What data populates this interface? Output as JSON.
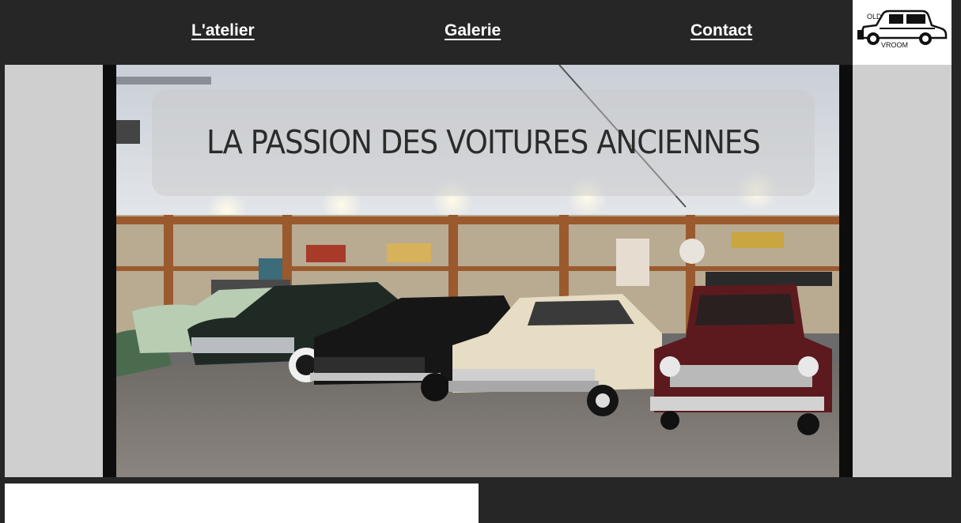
{
  "nav": {
    "atelier": "L'atelier",
    "galerie": "Galerie",
    "contact": "Contact"
  },
  "logo": {
    "top_text": "OLD",
    "bottom_text": "VROOM",
    "icon": "vintage-car-icon"
  },
  "hero": {
    "title": "LA PASSION DES VOITURES ANCIENNES",
    "image": "vintage-cars-garage-photo"
  },
  "colors": {
    "background": "#262626",
    "side": "#cfcfcf",
    "nav_text": "#ffffff",
    "title_text": "#2b2b2b"
  }
}
